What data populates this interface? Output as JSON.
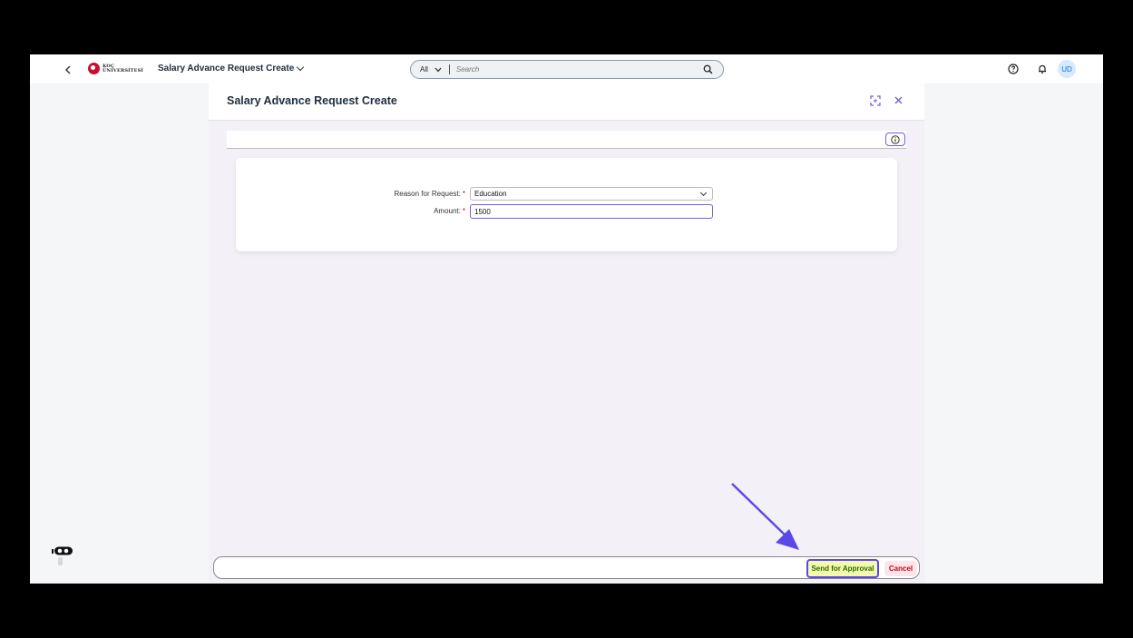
{
  "shellbar": {
    "logo_line1": "KOÇ",
    "logo_line2": "ÜNİVERSİTESİ",
    "app_title": "Salary Advance Request Create",
    "search_scope": "All",
    "search_placeholder": "Search",
    "avatar_initials": "UD"
  },
  "dialog": {
    "title": "Salary Advance Request Create",
    "fields": {
      "reason_label": "Reason for Request:",
      "reason_value": "Education",
      "amount_label": "Amount:",
      "amount_value": "1500",
      "required_mark": "*"
    }
  },
  "footer": {
    "send_label": "Send for Approval",
    "cancel_label": "Cancel"
  },
  "colors": {
    "accent": "#7b5cd6",
    "annotation": "#5b48e8",
    "send_bg": "#f4f9b0",
    "cancel_text": "#c7001a"
  }
}
